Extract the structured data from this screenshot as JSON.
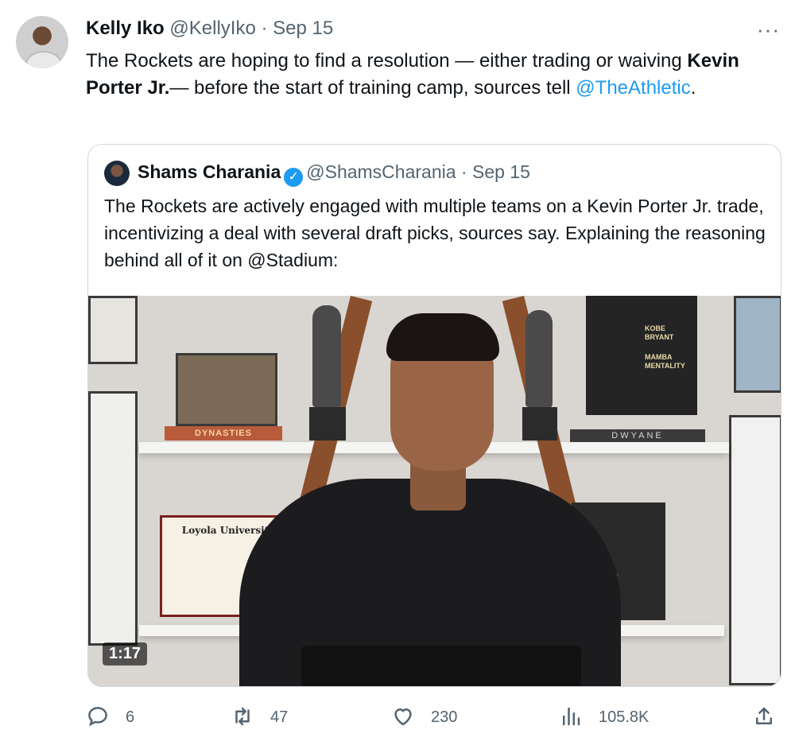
{
  "tweet": {
    "author_name": "Kelly Iko",
    "author_handle": "@KellyIko",
    "separator": " · ",
    "date": "Sep 15",
    "more_label": "···",
    "text_part1": "The Rockets are hoping to find a resolution — either trading or waiving ",
    "text_bold": "Kevin Porter Jr.",
    "text_part2": "— before the start of training camp, sources tell ",
    "text_link": "@TheAthletic",
    "text_part3": "."
  },
  "quote": {
    "author_name": "Shams Charania",
    "verified_mark": "✓",
    "author_handle": "@ShamsCharania",
    "separator": " · ",
    "date": "Sep 15",
    "text": "The Rockets are actively engaged with multiple teams on a Kevin Porter Jr. trade, incentivizing a deal with several draft picks, sources say. Explaining the reasoning behind all of it on @Stadium:",
    "video_duration": "1:17",
    "video_text": {
      "book_dynasties": "DYNASTIES",
      "book_kobe": "KOBE BRYANT",
      "book_mamba": "MAMBA MENTALITY",
      "book_dwyane": "DWYANE",
      "diploma_title": "Loyola University",
      "stadium_box": "ADIUM"
    }
  },
  "actions": {
    "replies": "6",
    "retweets": "47",
    "likes": "230",
    "views": "105.8K"
  },
  "icons": {
    "reply": "reply-icon",
    "retweet": "retweet-icon",
    "like": "heart-icon",
    "views": "views-icon",
    "share": "share-icon"
  },
  "colors": {
    "link": "#1d9bf0",
    "secondary_text": "#536471",
    "verified": "#1d9bf0"
  }
}
